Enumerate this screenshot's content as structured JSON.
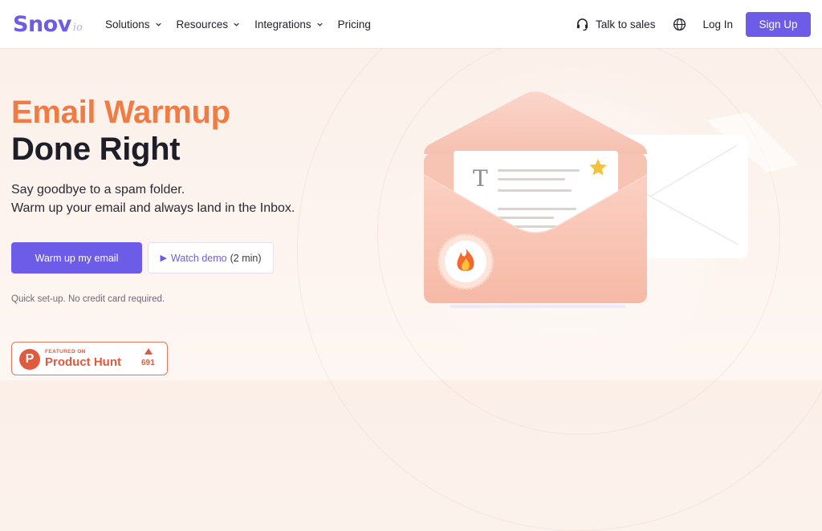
{
  "header": {
    "logo_main": "Snov",
    "logo_sub": "io",
    "nav": [
      {
        "label": "Solutions",
        "has_dropdown": true
      },
      {
        "label": "Resources",
        "has_dropdown": true
      },
      {
        "label": "Integrations",
        "has_dropdown": true
      },
      {
        "label": "Pricing",
        "has_dropdown": false
      }
    ],
    "talk_to_sales": "Talk to sales",
    "login": "Log In",
    "signup": "Sign Up",
    "icons": {
      "sales": "headset-icon",
      "language": "globe-icon",
      "dropdown": "chevron-down-icon"
    }
  },
  "hero": {
    "title_line1": "Email Warmup",
    "title_line2": "Done Right",
    "subtitle_line1": "Say goodbye to a spam folder.",
    "subtitle_line2": "Warm up your email and always land in the Inbox.",
    "cta_primary": "Warm up my email",
    "cta_demo": "Watch demo",
    "cta_demo_duration": "(2 min)",
    "note": "Quick set-up. No credit card required."
  },
  "product_hunt": {
    "featured": "FEATURED ON",
    "name": "Product Hunt",
    "logo_letter": "P",
    "votes": "691"
  },
  "illustration": {
    "letter_glyph": "T",
    "icons": [
      "envelope-icon",
      "star-icon",
      "fire-icon"
    ]
  },
  "colors": {
    "brand_purple": "#6c5ce7",
    "title_orange": "#f07c45",
    "product_hunt": "#e05a3f",
    "star": "#f5c33b"
  }
}
